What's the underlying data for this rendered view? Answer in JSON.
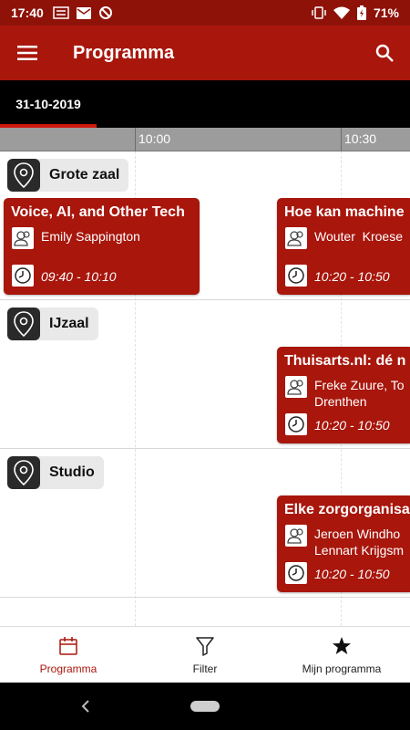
{
  "status_bar": {
    "time": "17:40",
    "battery": "71%",
    "left_icons": [
      "news-icon",
      "mail-icon",
      "sync-icon"
    ],
    "right_icons": [
      "vibrate-icon",
      "wifi-icon",
      "battery-icon"
    ]
  },
  "app_bar": {
    "title": "Programma",
    "menu_icon": "hamburger-menu-icon",
    "search_icon": "search-icon"
  },
  "date_tabs": [
    {
      "label": "31-10-2019",
      "selected": true
    }
  ],
  "time_header": [
    "10:00",
    "10:30"
  ],
  "rooms": [
    {
      "name": "Grote zaal",
      "sessions": [
        {
          "title": "Voice, AI, and Other Tech",
          "speakers": [
            "Emily Sappington"
          ],
          "time": "09:40 - 10:10"
        },
        {
          "title": "Hoe kan machine",
          "speakers": [
            "Wouter  Kroese"
          ],
          "time": "10:20 - 10:50"
        }
      ]
    },
    {
      "name": "IJzaal",
      "sessions": [
        {
          "title": "Thuisarts.nl: dé n",
          "speakers": [
            "Freke Zuure, To",
            "Drenthen"
          ],
          "time": "10:20 - 10:50"
        }
      ]
    },
    {
      "name": "Studio",
      "sessions": [
        {
          "title": "Elke zorgorganisa",
          "speakers": [
            "Jeroen Windho",
            "Lennart Krijgsm"
          ],
          "time": "10:20 - 10:50"
        }
      ]
    }
  ],
  "bottom_nav": [
    {
      "label": "Programma",
      "icon": "calendar-icon",
      "active": true
    },
    {
      "label": "Filter",
      "icon": "filter-icon",
      "active": false
    },
    {
      "label": "Mijn programma",
      "icon": "star-icon",
      "active": false
    }
  ],
  "colors": {
    "status_bar": "#8e1208",
    "app_bar": "#a8160c",
    "accent": "#d0180c",
    "session_card": "#a8160c"
  }
}
